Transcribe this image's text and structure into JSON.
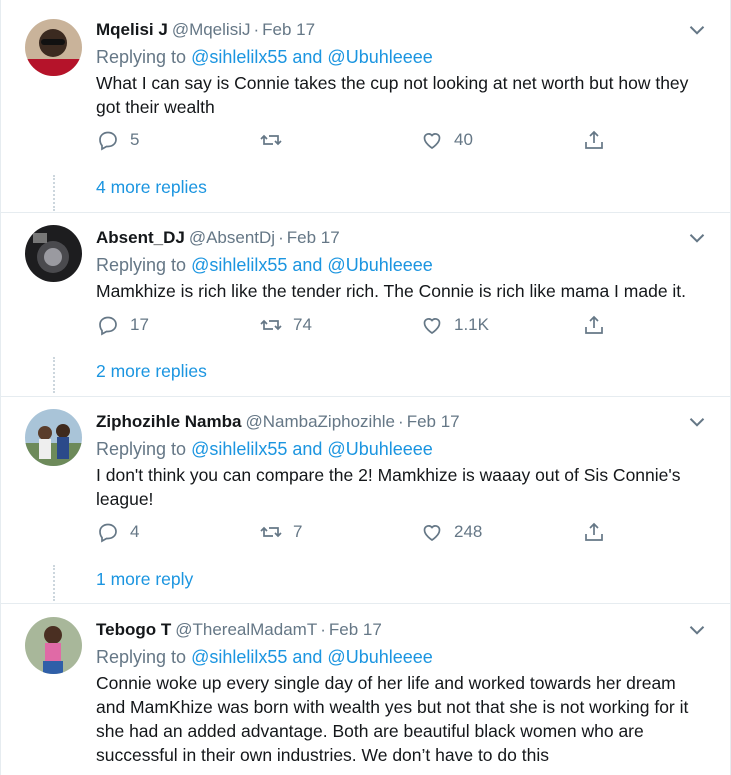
{
  "tweets": [
    {
      "name": "Mqelisi J",
      "handle": "@MqelisiJ",
      "separator": "·",
      "date": "Feb 17",
      "replying_prefix": "Replying to",
      "replying_users": "@sihlelilx55 and @Ubuhleeee",
      "text": "What I can say is Connie takes the cup not looking at net worth but how they got their wealth",
      "replies": "5",
      "retweets": "",
      "likes": "40",
      "more_replies": "4 more replies"
    },
    {
      "name": "Absent_DJ",
      "handle": "@AbsentDj",
      "separator": "·",
      "date": "Feb 17",
      "replying_prefix": "Replying to",
      "replying_users": "@sihlelilx55 and @Ubuhleeee",
      "text": "Mamkhize is rich like the tender rich. The Connie is rich like mama I made it.",
      "replies": "17",
      "retweets": "74",
      "likes": "1.1K",
      "more_replies": "2 more replies"
    },
    {
      "name": "Ziphozihle Namba",
      "handle": "@NambaZiphozihle",
      "separator": "·",
      "date": "Feb 17",
      "replying_prefix": "Replying to",
      "replying_users": "@sihlelilx55 and @Ubuhleeee",
      "text": "I don't think you can compare the 2! Mamkhize is waaay out of Sis Connie's league!",
      "replies": "4",
      "retweets": "7",
      "likes": "248",
      "more_replies": "1 more reply"
    },
    {
      "name": "Tebogo T",
      "handle": "@TherealMadamT",
      "separator": "·",
      "date": "Feb 17",
      "replying_prefix": "Replying to",
      "replying_users": "@sihlelilx55 and @Ubuhleeee",
      "text": "Connie woke up every single day of her life and worked towards her dream and MamKhize was born with wealth yes but not that she is not working for it she had an added advantage. Both are beautiful black women who are successful in their own industries. We don’t have to do this"
    }
  ],
  "icons": {
    "reply": "reply-icon",
    "retweet": "retweet-icon",
    "like": "heart-icon",
    "share": "share-icon",
    "caret": "chevron-down-icon"
  },
  "colors": {
    "link": "#1b95e0",
    "secondary_text": "#657786",
    "primary_text": "#14171a",
    "divider": "#e6ecf0"
  }
}
